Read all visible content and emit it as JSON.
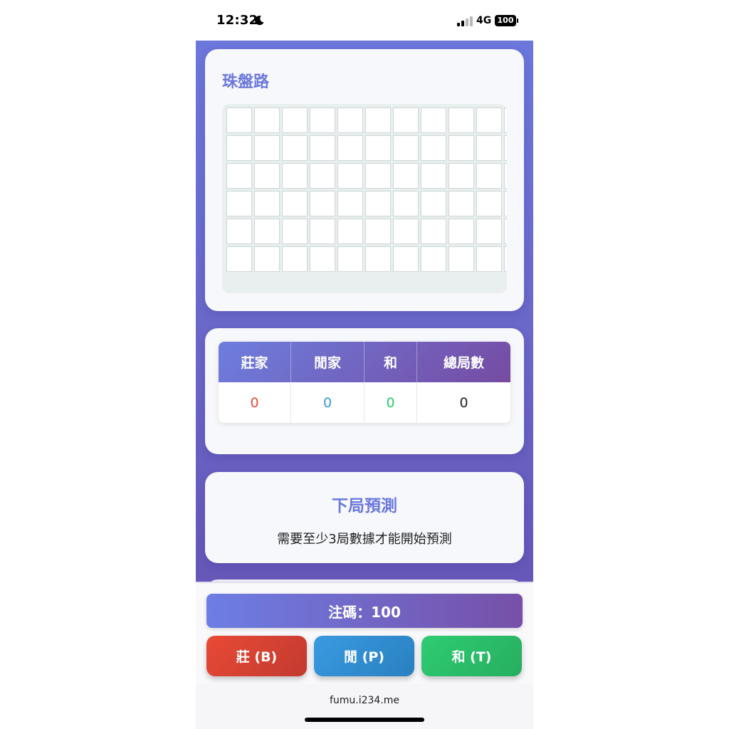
{
  "status_bar": {
    "time": "12:32",
    "network": "4G",
    "battery": "100",
    "icons": [
      "moon-icon",
      "signal-icon",
      "battery-icon"
    ]
  },
  "bead_road": {
    "title": "珠盤路",
    "rows": 6,
    "columns": 11
  },
  "stats": {
    "headers": [
      "莊家",
      "閒家",
      "和",
      "總局數"
    ],
    "values": [
      "0",
      "0",
      "0",
      "0"
    ],
    "colors": [
      "#e74c3c",
      "#3498db",
      "#2ecc71",
      "#222222"
    ]
  },
  "prediction": {
    "title": "下局預測",
    "message": "需要至少3局數據才能開始預測"
  },
  "controls": {
    "chip_label": "注碼：100",
    "banker_label": "莊 (B)",
    "player_label": "閒 (P)",
    "tie_label": "和 (T)"
  },
  "browser": {
    "url": "fumu.i234.me"
  },
  "colors": {
    "accent": "#6b78dc",
    "gradient_start": "#6d7ede",
    "gradient_end": "#764ba2",
    "banker": "#e74c3c",
    "player": "#3498db",
    "tie": "#2ecc71"
  }
}
